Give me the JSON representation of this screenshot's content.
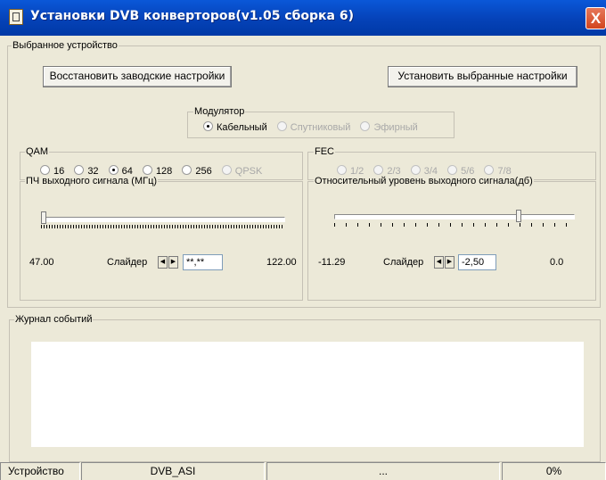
{
  "window": {
    "title": "Установки DVB конверторов(v1.05 сборка 6)",
    "close_label": "X"
  },
  "device": {
    "legend": "Выбранное устройство",
    "restore_button": "Восстановить заводские настройки",
    "apply_button": "Установить выбранные настройки"
  },
  "modulator": {
    "legend": "Модулятор",
    "options": [
      "Кабельный",
      "Спутниковый",
      "Эфирный"
    ],
    "selected": "Кабельный"
  },
  "qam": {
    "legend": "QAM",
    "options": [
      "16",
      "32",
      "64",
      "128",
      "256",
      "QPSK"
    ],
    "selected": "64"
  },
  "fec": {
    "legend": "FEC",
    "options": [
      "1/2",
      "2/3",
      "3/4",
      "5/6",
      "7/8"
    ]
  },
  "if_signal": {
    "legend": "ПЧ выходного сигнала (МГц)",
    "min": "47.00",
    "max": "122.00",
    "slider_label": "Слайдер",
    "value": "**,**",
    "position": 0.0
  },
  "level_signal": {
    "legend": "Относительный уровень выходного сигнала(дб)",
    "min": "-11.29",
    "max": "0.0",
    "slider_label": "Слайдер",
    "value": "-2,50",
    "position": 0.78
  },
  "log": {
    "legend": "Журнал событий"
  },
  "statusbar": {
    "device_label": "Устройство",
    "device_value": "DVB_ASI",
    "middle": "...",
    "progress": "0%"
  }
}
